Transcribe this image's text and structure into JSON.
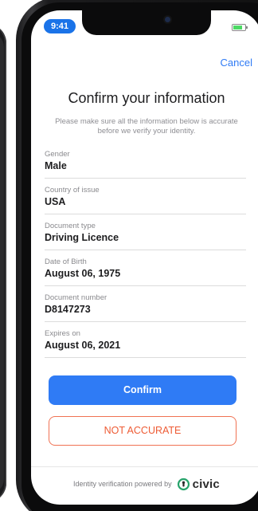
{
  "status_bar": {
    "time": "9:41"
  },
  "nav": {
    "cancel_label": "Cancel"
  },
  "header": {
    "title": "Confirm your information",
    "subtitle": "Please make sure all the information below is accurate before we verify your identity."
  },
  "fields": [
    {
      "label": "Gender",
      "value": "Male"
    },
    {
      "label": "Country of issue",
      "value": "USA"
    },
    {
      "label": "Document type",
      "value": "Driving Licence"
    },
    {
      "label": "Date of Birth",
      "value": "August 06, 1975"
    },
    {
      "label": "Document number",
      "value": "D8147273"
    },
    {
      "label": "Expires on",
      "value": "August 06, 2021"
    }
  ],
  "actions": {
    "confirm_label": "Confirm",
    "not_accurate_label": "NOT ACCURATE"
  },
  "footer": {
    "powered_by": "Identity verification powered by",
    "brand": "civic"
  },
  "colors": {
    "accent": "#2f7bf5",
    "danger": "#ee5b34",
    "brand_green": "#27a36b"
  }
}
